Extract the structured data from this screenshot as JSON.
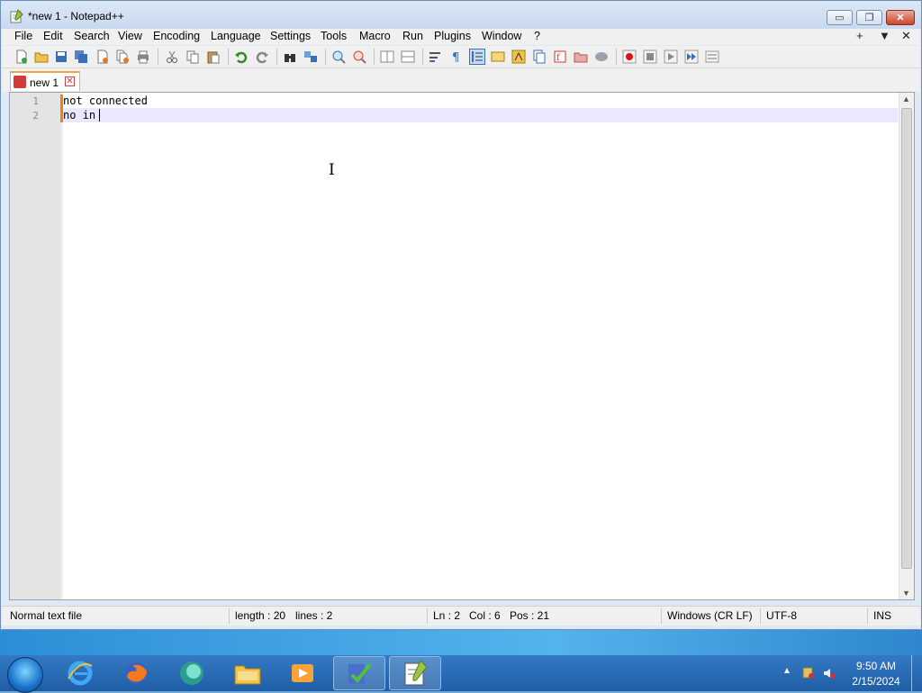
{
  "window": {
    "title": "*new 1 - Notepad++",
    "controls": {
      "minimize": "▭",
      "maximize": "❐",
      "close": "✕"
    }
  },
  "menu": {
    "items": [
      "File",
      "Edit",
      "Search",
      "View",
      "Encoding",
      "Language",
      "Settings",
      "Tools",
      "Macro",
      "Run",
      "Plugins",
      "Window",
      "?"
    ],
    "right": [
      "+",
      "▼",
      "✕"
    ]
  },
  "toolbar": {
    "buttons": [
      "new-file-icon",
      "open-file-icon",
      "save-icon",
      "save-all-icon",
      "close-icon",
      "close-all-icon",
      "print-icon",
      "cut-icon",
      "copy-icon",
      "paste-icon",
      "undo-icon",
      "redo-icon",
      "find-icon",
      "replace-icon",
      "zoom-in-icon",
      "zoom-out-icon",
      "sync-vertical-icon",
      "sync-horizontal-icon",
      "word-wrap-icon",
      "show-all-chars-icon",
      "indent-guide-icon",
      "user-language-icon",
      "doc-map-icon",
      "doc-list-icon",
      "function-list-icon",
      "folder-workspace-icon",
      "monitoring-icon",
      "record-macro-icon",
      "stop-record-icon",
      "play-macro-icon",
      "run-macro-multiple-icon",
      "save-macro-icon"
    ]
  },
  "tabs": [
    {
      "label": "new 1",
      "close": "✕"
    }
  ],
  "editor": {
    "lines": [
      {
        "number": "1",
        "text": "not connected"
      },
      {
        "number": "2",
        "text": "no in"
      }
    ]
  },
  "status": {
    "file_type": "Normal text file",
    "length": "length : 20",
    "lines": "lines : 2",
    "ln": "Ln : 2",
    "col": "Col : 6",
    "pos": "Pos : 21",
    "eol": "Windows (CR LF)",
    "encoding": "UTF-8",
    "mode": "INS"
  },
  "taskbar": {
    "apps": [
      "internet-explorer-icon",
      "firefox-icon",
      "chat-icon",
      "file-explorer-icon",
      "media-player-icon",
      "task-checker-icon",
      "notepad-plus-plus-icon"
    ],
    "clock_time": "9:50 AM",
    "clock_date": "2/15/2024"
  },
  "colors": {
    "accent_tab": "#f4a24b",
    "change_marker": "#f07f22",
    "current_line": "#e8e8ff"
  }
}
